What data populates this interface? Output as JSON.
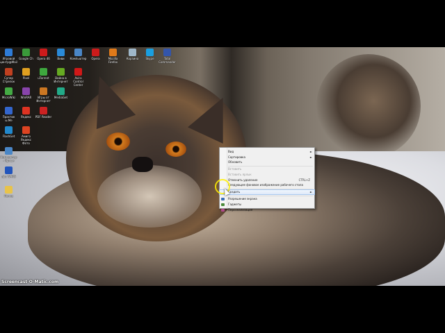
{
  "desktop": {
    "icons": [
      {
        "label": "Игровой центр@Mail",
        "icon": "game-center-icon",
        "color": "#2e7bd6"
      },
      {
        "label": "Google Ch",
        "icon": "chrome-icon",
        "color": "#3a9a3a"
      },
      {
        "label": "Opera 46",
        "icon": "opera-icon",
        "color": "#cc1b1b"
      },
      {
        "label": "Виви",
        "icon": "app-icon",
        "color": "#2a8ad8"
      },
      {
        "label": "Компьютер",
        "icon": "computer-icon",
        "color": "#4a86c6"
      },
      {
        "label": "Opera",
        "icon": "opera-icon",
        "color": "#cc1b1b"
      },
      {
        "label": "Mozilla Firefox",
        "icon": "firefox-icon",
        "color": "#e07a1a"
      },
      {
        "label": "Корзина",
        "icon": "recycle-bin-icon",
        "color": "#9fb7c9"
      },
      {
        "label": "Skype",
        "icon": "skype-icon",
        "color": "#1a9fe0"
      },
      {
        "label": "Total Commander",
        "icon": "total-commander-icon",
        "color": "#3355aa"
      },
      {
        "label": "Супер Стрелок",
        "icon": "game-icon",
        "color": "#c04020"
      },
      {
        "label": "Pixel",
        "icon": "pixel-icon",
        "color": "#e0a020"
      },
      {
        "label": "uTorrent",
        "icon": "utorrent-icon",
        "color": "#3ea83e"
      },
      {
        "label": "Война в Интернет",
        "icon": "game-icon",
        "color": "#66aa22"
      },
      {
        "label": "Avira Control Center",
        "icon": "avira-icon",
        "color": "#d01818"
      },
      {
        "label": "MicroWiki",
        "icon": "app-icon",
        "color": "#44aa44"
      },
      {
        "label": "WinRAR",
        "icon": "winrar-icon",
        "color": "#8844aa"
      },
      {
        "label": "Игры от Интернет",
        "icon": "game-icon",
        "color": "#cc7722"
      },
      {
        "label": "MediaGet",
        "icon": "mediaget-icon",
        "color": "#22aa88"
      },
      {
        "label": "Практик ы.Ме",
        "icon": "app-icon",
        "color": "#3366cc"
      },
      {
        "label": "Яндекс",
        "icon": "yandex-icon",
        "color": "#dd3322"
      },
      {
        "label": "PDF Reader",
        "icon": "pdf-icon",
        "color": "#cc2222"
      },
      {
        "label": "FlashGet",
        "icon": "flashget-icon",
        "color": "#2288cc"
      },
      {
        "label": "Амиго Яндекс Фото",
        "icon": "amigo-icon",
        "color": "#dd4422"
      },
      {
        "label": "Компьютер - Ярлык",
        "icon": "shortcut-icon",
        "color": "#4a86c6"
      },
      {
        "label": "abc WARS",
        "icon": "game-icon",
        "color": "#2255bb"
      },
      {
        "label": "Папка",
        "icon": "folder-icon",
        "color": "#e8c34a"
      }
    ]
  },
  "context_menu": {
    "items": [
      {
        "label": "Вид",
        "shortcut": "",
        "arrow": "►",
        "state": "normal",
        "sep_after": false
      },
      {
        "label": "Сортировка",
        "shortcut": "",
        "arrow": "►",
        "state": "normal",
        "sep_after": false
      },
      {
        "label": "Обновить",
        "shortcut": "",
        "arrow": "",
        "state": "normal",
        "sep_after": true
      },
      {
        "label": "Вставить",
        "shortcut": "",
        "arrow": "",
        "state": "disabled",
        "sep_after": false
      },
      {
        "label": "Вставить ярлык",
        "shortcut": "",
        "arrow": "",
        "state": "disabled",
        "sep_after": false
      },
      {
        "label": "Отменить удаление",
        "shortcut": "CTRL+Z",
        "arrow": "",
        "state": "normal",
        "sep_after": false
      },
      {
        "label": "Следующее фоновое изображение рабочего стола",
        "shortcut": "",
        "arrow": "",
        "state": "normal",
        "sep_after": true
      },
      {
        "label": "Создать",
        "shortcut": "",
        "arrow": "►",
        "state": "highlighted",
        "sep_after": true
      },
      {
        "label": "Разрешение экрана",
        "shortcut": "",
        "arrow": "",
        "state": "normal",
        "sep_after": false
      },
      {
        "label": "Гаджеты",
        "shortcut": "",
        "arrow": "",
        "state": "normal",
        "sep_after": false
      },
      {
        "label": "Персонализация",
        "shortcut": "",
        "arrow": "",
        "state": "normal",
        "sep_after": false
      }
    ]
  },
  "watermark": "Screencast-O-Matic.com"
}
